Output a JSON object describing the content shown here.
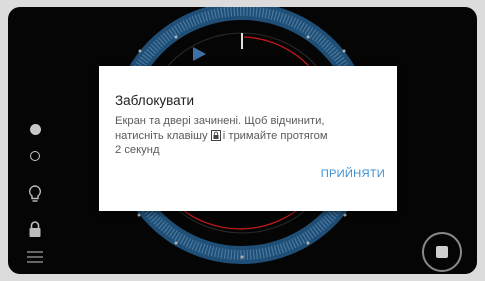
{
  "dialog": {
    "title": "Заблокувати",
    "body_line1": "Екран та двері зачинені. Щоб відчинити,",
    "body_line2_a": "натисніть клавішу",
    "body_line2_b": "і тримайте протягом",
    "body_line3": "2 секунд",
    "accept_label": "ПРИЙНЯТИ"
  },
  "side_icons": [
    "dot-filled-icon",
    "dot-outline-icon",
    "bulb-icon",
    "lock-icon",
    "menu-icon"
  ],
  "controls": {
    "stop_icon": "stop-icon"
  },
  "colors": {
    "accent": "#3d8fd0",
    "dial_ring": "#1f5d8a",
    "red_arc": "#c21a1a"
  }
}
